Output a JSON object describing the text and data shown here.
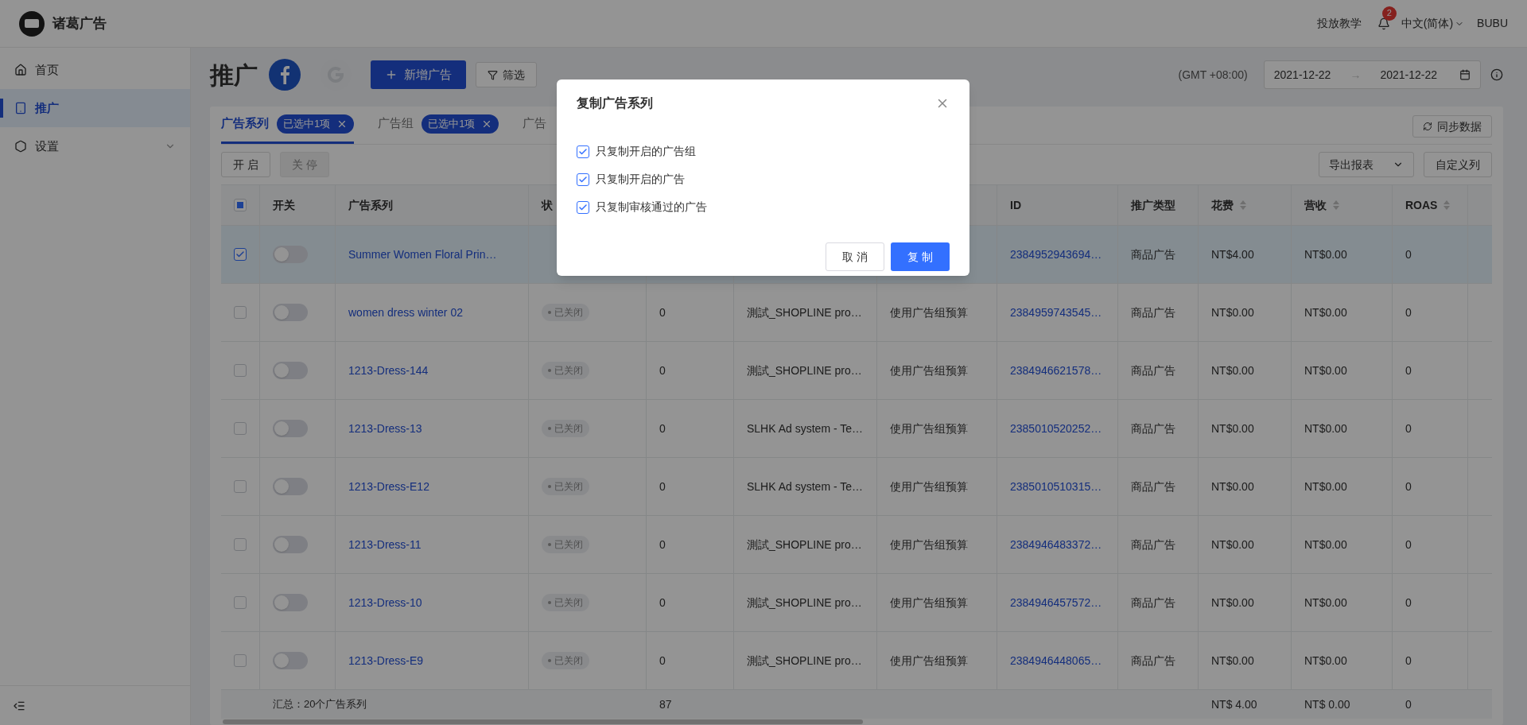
{
  "app": {
    "name": "诸葛广告"
  },
  "header": {
    "tutorial": "投放教学",
    "notifications": "2",
    "language": "中文(简体)",
    "user": "BUBU"
  },
  "sidebar": {
    "items": [
      {
        "label": "首页",
        "selected": false,
        "expandable": false
      },
      {
        "label": "推广",
        "selected": true,
        "expandable": false
      },
      {
        "label": "设置",
        "selected": false,
        "expandable": true
      }
    ]
  },
  "page": {
    "title": "推广",
    "platforms": [
      {
        "kind": "facebook",
        "selected": true
      },
      {
        "kind": "google",
        "selected": false
      }
    ],
    "add_button": "新增广告",
    "filter_button": "筛选",
    "timezone": "(GMT +08:00)",
    "date_from": "2021-12-22",
    "date_separator": "→",
    "date_to": "2021-12-22"
  },
  "tabs": [
    {
      "label": "广告系列",
      "selected": true,
      "badge": "已选中1项"
    },
    {
      "label": "广告组",
      "selected": false,
      "badge": "已选中1项"
    },
    {
      "label": "广告",
      "selected": false
    }
  ],
  "sync_button": "同步数据",
  "actions": [
    {
      "label": "开 启",
      "disabled": false
    },
    {
      "label": "关 停",
      "disabled": true
    }
  ],
  "export_select": "导出报表",
  "custom_columns_button": "自定义列",
  "table": {
    "select_all_partial": true,
    "columns": [
      {
        "label": "开关"
      },
      {
        "label": "广告系列"
      },
      {
        "label": "状"
      },
      {},
      {},
      {},
      {
        "label": "ID"
      },
      {
        "label": "推广类型"
      },
      {
        "label": "花费",
        "sortable": true
      },
      {
        "label": "营收",
        "sortable": true
      },
      {
        "label": "ROAS",
        "sortable": true
      }
    ],
    "rows": [
      {
        "checked": true,
        "on": false,
        "name": "Summer Women Floral Prin…",
        "id": "2384952943694…",
        "type": "商品广告",
        "spend": "NT$4.00",
        "revenue": "NT$0.00",
        "roas": "0"
      },
      {
        "checked": false,
        "on": false,
        "name": "women dress winter 02",
        "status": "已关闭",
        "count": "0",
        "source": "測試_SHOPLINE pro…",
        "budget": "使用广告组预算",
        "id": "2384959743545…",
        "type": "商品广告",
        "spend": "NT$0.00",
        "revenue": "NT$0.00",
        "roas": "0"
      },
      {
        "checked": false,
        "on": false,
        "name": "1213-Dress-144",
        "status": "已关闭",
        "count": "0",
        "source": "測試_SHOPLINE pro…",
        "budget": "使用广告组预算",
        "id": "2384946621578…",
        "type": "商品广告",
        "spend": "NT$0.00",
        "revenue": "NT$0.00",
        "roas": "0"
      },
      {
        "checked": false,
        "on": false,
        "name": "1213-Dress-13",
        "status": "已关闭",
        "count": "0",
        "source": "SLHK Ad system - Te…",
        "budget": "使用广告组预算",
        "id": "2385010520252…",
        "type": "商品广告",
        "spend": "NT$0.00",
        "revenue": "NT$0.00",
        "roas": "0"
      },
      {
        "checked": false,
        "on": false,
        "name": "1213-Dress-E12",
        "status": "已关闭",
        "count": "0",
        "source": "SLHK Ad system - Te…",
        "budget": "使用广告组预算",
        "id": "2385010510315…",
        "type": "商品广告",
        "spend": "NT$0.00",
        "revenue": "NT$0.00",
        "roas": "0"
      },
      {
        "checked": false,
        "on": false,
        "name": "1213-Dress-11",
        "status": "已关闭",
        "count": "0",
        "source": "測試_SHOPLINE pro…",
        "budget": "使用广告组预算",
        "id": "2384946483372…",
        "type": "商品广告",
        "spend": "NT$0.00",
        "revenue": "NT$0.00",
        "roas": "0"
      },
      {
        "checked": false,
        "on": false,
        "name": "1213-Dress-10",
        "status": "已关闭",
        "count": "0",
        "source": "測試_SHOPLINE pro…",
        "budget": "使用广告组预算",
        "id": "2384946457572…",
        "type": "商品广告",
        "spend": "NT$0.00",
        "revenue": "NT$0.00",
        "roas": "0"
      },
      {
        "checked": false,
        "on": false,
        "name": "1213-Dress-E9",
        "status": "已关闭",
        "count": "0",
        "source": "測試_SHOPLINE pro…",
        "budget": "使用广告组预算",
        "id": "2384946448065…",
        "type": "商品广告",
        "spend": "NT$0.00",
        "revenue": "NT$0.00",
        "roas": "0"
      }
    ],
    "summary": {
      "label": "汇总：20个广告系列",
      "count": "87",
      "spend": "NT$ 4.00",
      "revenue": "NT$ 0.00",
      "roas": "0"
    }
  },
  "dialog": {
    "title": "复制广告系列",
    "options": [
      {
        "label": "只复制开启的广告组",
        "checked": true
      },
      {
        "label": "只复制开启的广告",
        "checked": true
      },
      {
        "label": "只复制审核通过的广告",
        "checked": true
      }
    ],
    "cancel": "取 消",
    "confirm": "复 制"
  }
}
